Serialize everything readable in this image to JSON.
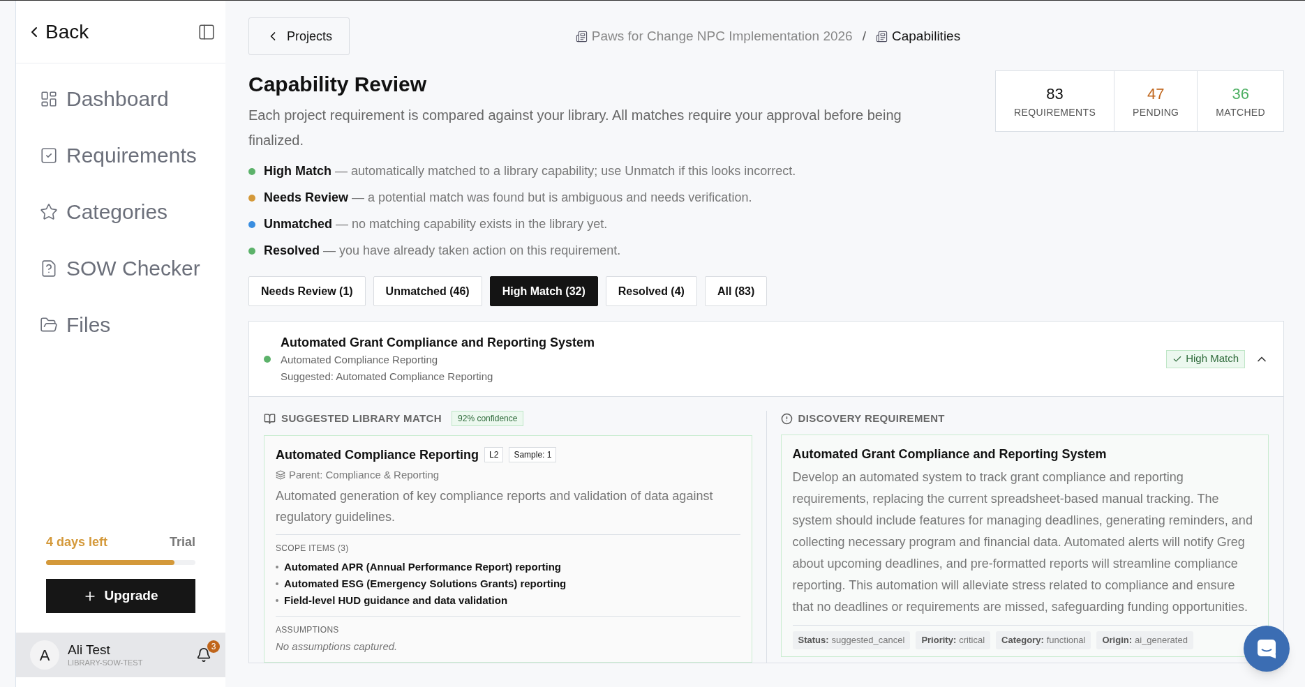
{
  "sidebar": {
    "back": "Back",
    "items": [
      {
        "label": "Dashboard",
        "kind": "dashboard",
        "selected": false
      },
      {
        "label": "Requirements",
        "kind": "requirements",
        "selected": false
      },
      {
        "label": "Categories",
        "kind": "categories",
        "selected": false
      },
      {
        "label": "SOW Checker",
        "kind": "checker",
        "selected": false
      },
      {
        "label": "Files",
        "kind": "files",
        "selected": false
      }
    ],
    "trial": {
      "days": "4 days left",
      "label": "Trial",
      "level": 0.86
    },
    "upgrade": "Upgrade",
    "user": {
      "avatar": "A",
      "name": "Ali Test",
      "org": "LIBRARY-SOW-TEST",
      "notifications": "3"
    }
  },
  "breadcrumb": {
    "back": "Projects",
    "items": [
      "Paws for Change NPC Implementation 2026",
      "Capabilities"
    ],
    "separator": "/"
  },
  "title": "Capability Review",
  "description": "Each project requirement is compared against your library. All matches require your approval before being finalized.",
  "stats": [
    {
      "value": "83",
      "label": "REQUIREMENTS",
      "color": "#111111"
    },
    {
      "value": "47",
      "label": "PENDING",
      "color": "#c0651b"
    },
    {
      "value": "36",
      "label": "MATCHED",
      "color": "#4caf62"
    }
  ],
  "legend": [
    {
      "text": "**High Match** — automatically matched to a library capability; use Unmatch if this looks incorrect.",
      "color": "#5cb26a"
    },
    {
      "text": "**Needs Review** — a potential match was found but is ambiguous and needs verification.",
      "color": "#d4993a"
    },
    {
      "text": "**Unmatched** — no matching capability exists in the library yet.",
      "color": "#3a8ee0"
    },
    {
      "text": "**Resolved** — you have already taken action on this requirement.",
      "color": "#5cb26a"
    }
  ],
  "filters": [
    {
      "label": "Needs Review (1)",
      "selected": false
    },
    {
      "label": "Unmatched (46)",
      "selected": false
    },
    {
      "label": "High Match (32)",
      "selected": true
    },
    {
      "label": "Resolved (4)",
      "selected": false
    },
    {
      "label": "All (83)",
      "selected": false
    }
  ],
  "card": {
    "title": "Automated Grant Compliance and Reporting System",
    "subtitle": "Automated Compliance Reporting",
    "suggested": "Suggested: Automated Compliance Reporting",
    "color": "#5cb26a",
    "badge": "High Match",
    "expanded": true,
    "match": {
      "heading": "SUGGESTED LIBRARY MATCH",
      "confidence": "92% confidence",
      "name": "Automated Compliance Reporting",
      "tags": [
        "L2",
        "Sample: 1"
      ],
      "parent": "Parent: Compliance & Reporting",
      "description": "Automated generation of key compliance reports and validation of data against regulatory guidelines.",
      "scope_heading": "SCOPE ITEMS (3)",
      "scope_items": [
        "Automated APR (Annual Performance Report) reporting",
        "Automated ESG (Emergency Solutions Grants) reporting",
        "Field-level HUD guidance and data validation"
      ],
      "assumptions_heading": "ASSUMPTIONS",
      "assumptions": "No assumptions captured."
    },
    "requirement": {
      "heading": "DISCOVERY REQUIREMENT",
      "title": "Automated Grant Compliance and Reporting System",
      "description": "Develop an automated system to track grant compliance and reporting requirements, replacing the current spreadsheet-based manual tracking. The system should include features for managing deadlines, generating reminders, and collecting necessary program and financial data. Automated alerts will notify Greg about upcoming deadlines, and pre-formatted reports will streamline compliance reporting. This automation will alleviate stress related to compliance and ensure that no deadlines or requirements are missed, safeguarding funding opportunities.",
      "meta": [
        {
          "key": "Status:",
          "value": "suggested_cancel"
        },
        {
          "key": "Priority:",
          "value": "critical"
        },
        {
          "key": "Category:",
          "value": "functional"
        },
        {
          "key": "Origin:",
          "value": "ai_generated"
        }
      ]
    }
  }
}
